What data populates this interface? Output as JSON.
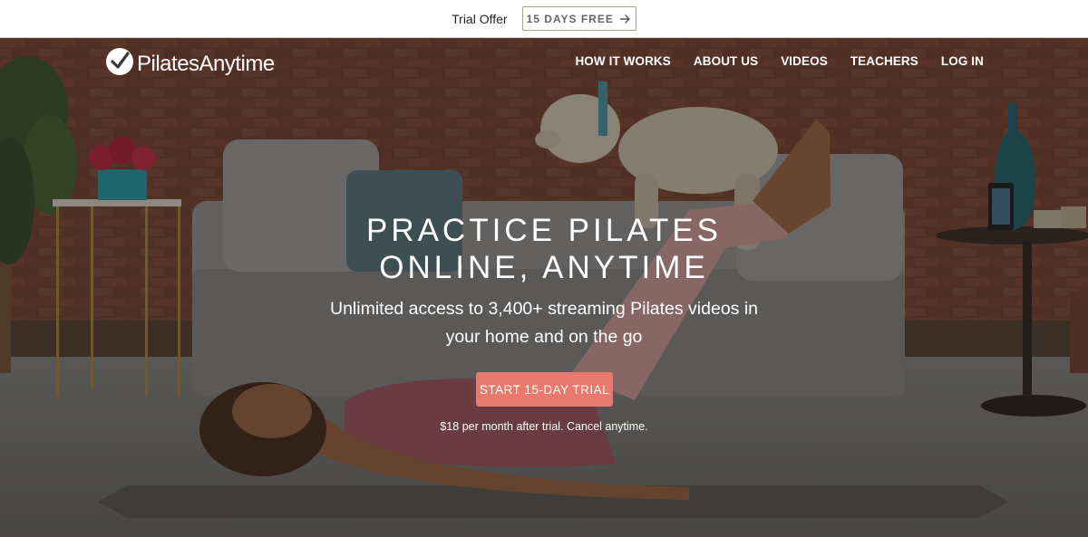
{
  "trial_bar": {
    "text": "Trial Offer",
    "button_label": "15 DAYS FREE",
    "button_icon": "arrow-right-icon"
  },
  "header": {
    "logo_text": "PilatesAnytime",
    "logo_icon": "checkmark-circle-logo",
    "nav": [
      {
        "label": "HOW IT WORKS"
      },
      {
        "label": "ABOUT US"
      },
      {
        "label": "VIDEOS"
      },
      {
        "label": "TEACHERS"
      },
      {
        "label": "LOG IN"
      }
    ]
  },
  "hero": {
    "title_line1": "PRACTICE PILATES",
    "title_line2": "ONLINE, ANYTIME",
    "subtitle": "Unlimited access to 3,400+ streaming Pilates videos in your home and on the go",
    "cta_label": "START 15-DAY TRIAL",
    "price_note": "$18 per month after trial. Cancel anytime."
  },
  "colors": {
    "cta": "#e8796c",
    "trial_border": "#9aa58a",
    "brick": "#6b3a2c",
    "sofa": "#9a9a98",
    "floor": "#8a8a8a"
  }
}
